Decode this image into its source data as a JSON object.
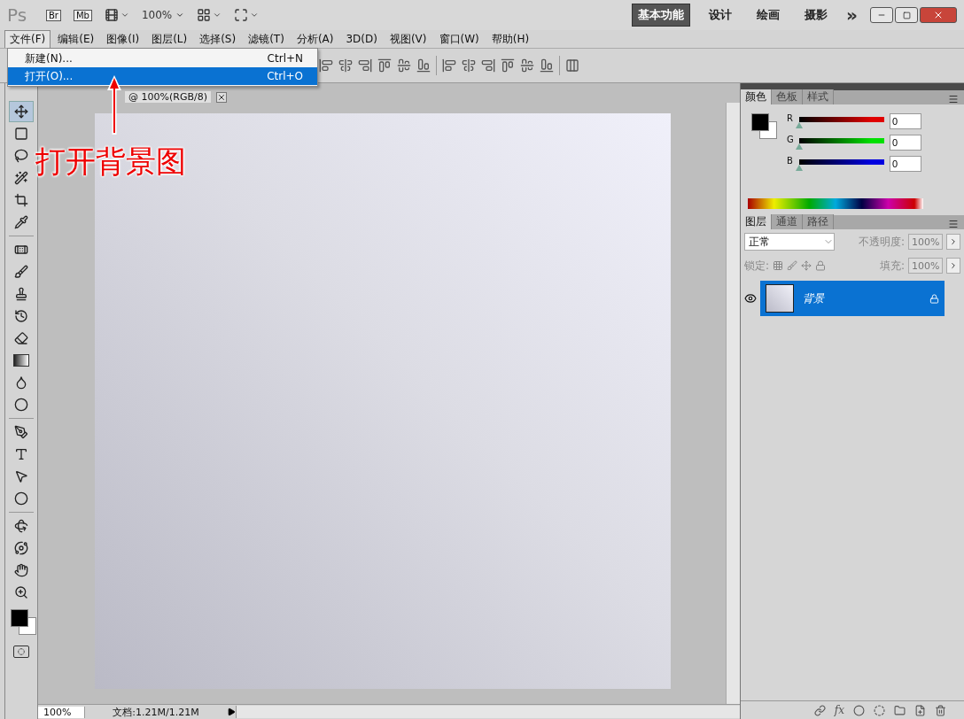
{
  "app_bar": {
    "logo": "Ps",
    "bridge": "Br",
    "mini_bridge": "Mb",
    "zoom": "100%",
    "workspaces": [
      {
        "label": "基本功能",
        "selected": true
      },
      {
        "label": "设计",
        "selected": false
      },
      {
        "label": "绘画",
        "selected": false
      },
      {
        "label": "摄影",
        "selected": false
      }
    ],
    "more": "»"
  },
  "menu_bar": [
    {
      "label": "文件(F)",
      "selected": true
    },
    {
      "label": "编辑(E)",
      "selected": false
    },
    {
      "label": "图像(I)",
      "selected": false
    },
    {
      "label": "图层(L)",
      "selected": false
    },
    {
      "label": "选择(S)",
      "selected": false
    },
    {
      "label": "滤镜(T)",
      "selected": false
    },
    {
      "label": "分析(A)",
      "selected": false
    },
    {
      "label": "3D(D)",
      "selected": false
    },
    {
      "label": "视图(V)",
      "selected": false
    },
    {
      "label": "窗口(W)",
      "selected": false
    },
    {
      "label": "帮助(H)",
      "selected": false
    }
  ],
  "file_menu": [
    {
      "label": "新建(N)...",
      "shortcut": "Ctrl+N",
      "selected": false
    },
    {
      "label": "打开(O)...",
      "shortcut": "Ctrl+O",
      "selected": true
    }
  ],
  "document": {
    "tab": "@ 100%(RGB/8)"
  },
  "annotation": "打开背景图",
  "tool_groups": [
    [
      {
        "kind": "move",
        "selected": true
      },
      {
        "kind": "marquee",
        "selected": false
      },
      {
        "kind": "lasso",
        "selected": false
      },
      {
        "kind": "wand",
        "selected": false
      },
      {
        "kind": "crop",
        "selected": false
      },
      {
        "kind": "eyedropper",
        "selected": false
      }
    ],
    [
      {
        "kind": "healing",
        "selected": false
      },
      {
        "kind": "brush",
        "selected": false
      },
      {
        "kind": "stamp",
        "selected": false
      },
      {
        "kind": "history",
        "selected": false
      },
      {
        "kind": "eraser",
        "selected": false
      },
      {
        "kind": "gradient",
        "selected": false
      },
      {
        "kind": "blur",
        "selected": false
      },
      {
        "kind": "dodge",
        "selected": false
      }
    ],
    [
      {
        "kind": "pen",
        "selected": false
      },
      {
        "kind": "type",
        "selected": false
      },
      {
        "kind": "path",
        "selected": false
      },
      {
        "kind": "shape",
        "selected": false
      }
    ],
    [
      {
        "kind": "rotate3d",
        "selected": false
      },
      {
        "kind": "orbit3d",
        "selected": false
      },
      {
        "kind": "hand",
        "selected": false
      },
      {
        "kind": "zoom",
        "selected": false
      }
    ]
  ],
  "color_panel": {
    "tabs": [
      {
        "label": "颜色",
        "selected": true
      },
      {
        "label": "色板",
        "selected": false
      },
      {
        "label": "样式",
        "selected": false
      }
    ],
    "channels": [
      {
        "label": "R",
        "value": "0",
        "level": 0,
        "color": "#e00000"
      },
      {
        "label": "G",
        "value": "0",
        "level": 0,
        "color": "#00e000"
      },
      {
        "label": "B",
        "value": "0",
        "level": 0,
        "color": "#0000e0"
      }
    ]
  },
  "layers_panel": {
    "tabs": [
      {
        "label": "图层",
        "selected": true
      },
      {
        "label": "通道",
        "selected": false
      },
      {
        "label": "路径",
        "selected": false
      }
    ],
    "blend_mode": "正常",
    "opacity_label": "不透明度:",
    "opacity": "100%",
    "lock_label": "锁定:",
    "fill_label": "填充:",
    "fill": "100%",
    "layers": [
      {
        "name": "背景",
        "selected": true,
        "visible": true,
        "locked": true
      }
    ],
    "fx": "fx"
  },
  "status_bar": {
    "zoom": "100%",
    "doc_info": "文档:1.21M/1.21M"
  }
}
